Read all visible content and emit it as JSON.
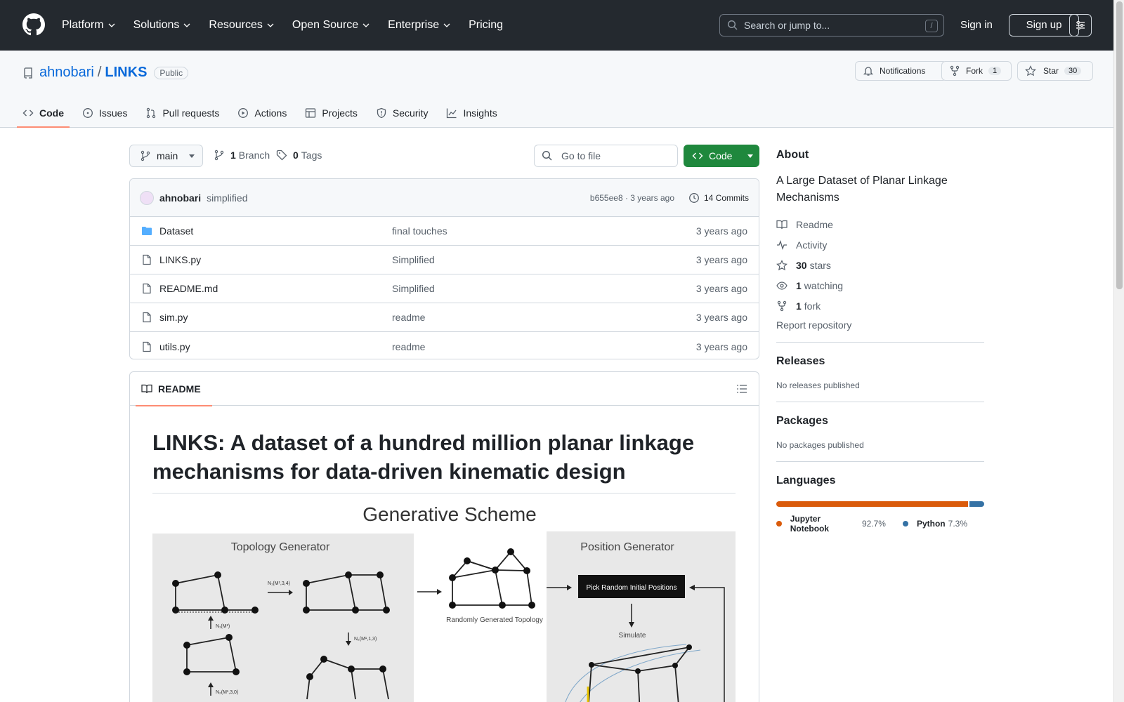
{
  "header": {
    "nav": [
      {
        "label": "Platform",
        "dropdown": true
      },
      {
        "label": "Solutions",
        "dropdown": true
      },
      {
        "label": "Resources",
        "dropdown": true
      },
      {
        "label": "Open Source",
        "dropdown": true
      },
      {
        "label": "Enterprise",
        "dropdown": true
      },
      {
        "label": "Pricing",
        "dropdown": false
      }
    ],
    "search_placeholder": "Search or jump to...",
    "search_shortcut": "/",
    "sign_in": "Sign in",
    "sign_up": "Sign up"
  },
  "repo": {
    "owner": "ahnobari",
    "separator": "/",
    "name": "LINKS",
    "visibility": "Public",
    "notifications_label": "Notifications",
    "fork_label": "Fork",
    "fork_count": "1",
    "star_label": "Star",
    "star_count": "30"
  },
  "tabs": [
    {
      "label": "Code",
      "icon": "code-icon",
      "selected": true
    },
    {
      "label": "Issues",
      "icon": "issue-icon",
      "selected": false
    },
    {
      "label": "Pull requests",
      "icon": "pull-request-icon",
      "selected": false
    },
    {
      "label": "Actions",
      "icon": "play-icon",
      "selected": false
    },
    {
      "label": "Projects",
      "icon": "table-icon",
      "selected": false
    },
    {
      "label": "Security",
      "icon": "shield-icon",
      "selected": false
    },
    {
      "label": "Insights",
      "icon": "graph-icon",
      "selected": false
    }
  ],
  "toolbar": {
    "branch": "main",
    "branch_count": "1",
    "branch_label": "Branch",
    "tag_count": "0",
    "tag_label": "Tags",
    "goto_placeholder": "Go to file",
    "code_label": "Code"
  },
  "commit": {
    "author": "ahnobari",
    "message": "simplified",
    "meta": "b655ee8 · 3 years ago",
    "commits_label": "14 Commits"
  },
  "files": [
    {
      "name": "Dataset",
      "type": "folder",
      "message": "final touches",
      "age": "3 years ago"
    },
    {
      "name": "LINKS.py",
      "type": "file",
      "message": "Simplified",
      "age": "3 years ago"
    },
    {
      "name": "README.md",
      "type": "file",
      "message": "Simplified",
      "age": "3 years ago"
    },
    {
      "name": "sim.py",
      "type": "file",
      "message": "readme",
      "age": "3 years ago"
    },
    {
      "name": "utils.py",
      "type": "file",
      "message": "readme",
      "age": "3 years ago"
    }
  ],
  "readme": {
    "tab_label": "README",
    "title": "LINKS: A dataset of a hundred million planar linkage mechanisms for data-driven kinematic design",
    "figure": {
      "title": "Generative Scheme",
      "topology_title": "Topology Generator",
      "position_title": "Position Generator",
      "random_topology": "Randomly Generated Topology",
      "pick_random": "Pick Random Initial Positions",
      "simulate": "Simulate",
      "op1": "N₁(M¹,3,4)",
      "op2": "N₁(M¹)",
      "op3": "N₂(M¹,1,3)",
      "op4": "N₂(M¹,3,0)"
    }
  },
  "sidebar": {
    "about_heading": "About",
    "description": "A Large Dataset of Planar Linkage Mechanisms",
    "readme": "Readme",
    "activity": "Activity",
    "stars_count": "30",
    "stars_label": "stars",
    "watching_count": "1",
    "watching_label": "watching",
    "fork_count": "1",
    "fork_label": "fork",
    "report": "Report repository",
    "releases_heading": "Releases",
    "releases_sub": "No releases published",
    "packages_heading": "Packages",
    "packages_sub": "No packages published",
    "languages_heading": "Languages",
    "languages": [
      {
        "name": "Jupyter Notebook",
        "percent": "92.7%",
        "value": 92.7,
        "color": "#DA5B0B"
      },
      {
        "name": "Python",
        "percent": "7.3%",
        "value": 7.3,
        "color": "#3572A5"
      }
    ]
  }
}
